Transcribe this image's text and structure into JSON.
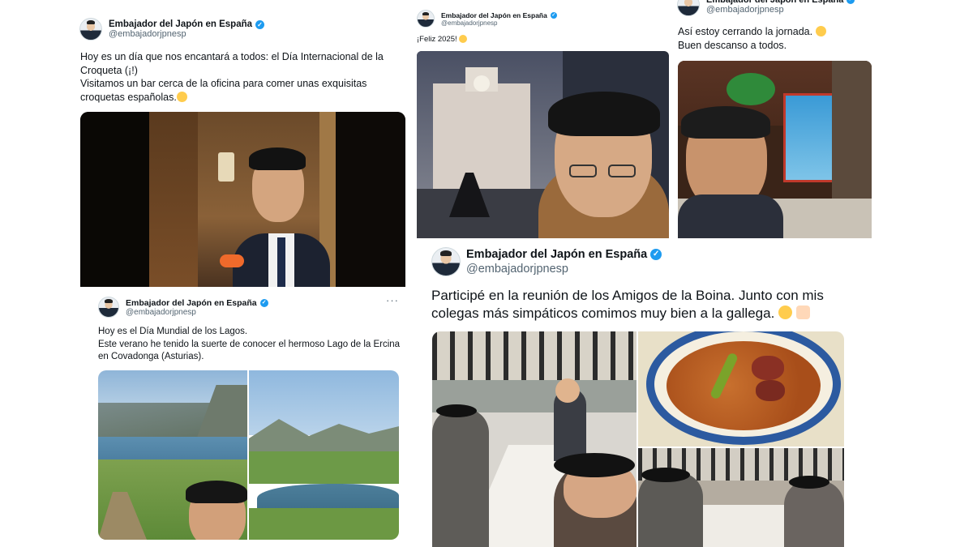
{
  "account": {
    "display_name": "Embajador del Japón en España",
    "handle": "@embajadorjpnesp",
    "verified_glyph": "✓"
  },
  "tweet_croqueta": {
    "text": "Hoy es un día que nos encantará a todos: el Día Internacional de la Croqueta (¡!)\nVisitamos un bar cerca de la oficina para comer unas exquisitas croquetas españolas.",
    "emoji_icon": "grinning-face-icon",
    "media_alt": "ambassador-holding-croqueta-photo"
  },
  "tweet_lagos": {
    "more_label": "···",
    "text": "Hoy es el Día Mundial de los Lagos.\nEste verano he tenido la suerte de conocer el hermoso Lago de la Ercina en Covadonga (Asturias).",
    "media_alt": [
      "lake-ercina-selfie-photo",
      "lake-ercina-landscape-photo"
    ]
  },
  "tweet_2025": {
    "text": "¡Feliz 2025!",
    "emoji_icon": "hugging-face-icon",
    "media_alt": "puerta-del-sol-fireworks-selfie-photo"
  },
  "tweet_jornada": {
    "text": "Así estoy cerrando la jornada.",
    "text_2": "Buen descanso a todos.",
    "emoji_icon": "grinning-face-icon",
    "media_alt": "ambassador-evening-bar-photo"
  },
  "tweet_boina": {
    "text": "Participé en la reunión de los Amigos de la Boina. Junto con mis colegas más simpáticos comimos muy bien a la gallega.",
    "emoji_icons": [
      "face-savoring-food-icon",
      "thumbs-up-icon"
    ],
    "media_alt": [
      "boina-group-lunch-photo",
      "fabada-bowl-photo",
      "boina-table-photo"
    ]
  },
  "colors": {
    "verified_blue": "#1d9bf0",
    "text_primary": "#0f1419",
    "text_secondary": "#536471"
  }
}
